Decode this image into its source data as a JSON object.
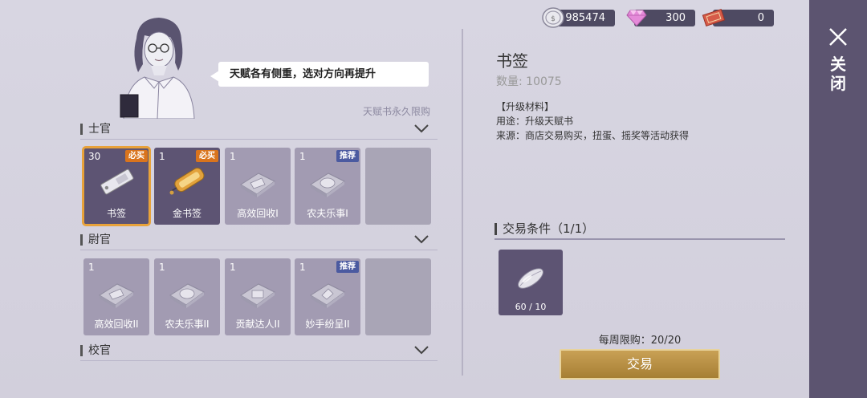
{
  "currency": {
    "silver": "985474",
    "gems": "300",
    "tickets": "0"
  },
  "bubble_text": "天赋各有侧重，选对方向再提升",
  "perm_note": "天赋书永久限购",
  "close_label": "关闭",
  "sections": [
    {
      "title": "士官",
      "items": [
        {
          "count": "30",
          "name": "书签",
          "badge": "必买",
          "badge_type": "must"
        },
        {
          "count": "1",
          "name": "金书签",
          "badge": "必买",
          "badge_type": "must"
        },
        {
          "count": "1",
          "name": "高效回收I",
          "badge": "",
          "badge_type": ""
        },
        {
          "count": "1",
          "name": "农夫乐事I",
          "badge": "推荐",
          "badge_type": "rec"
        }
      ]
    },
    {
      "title": "尉官",
      "items": [
        {
          "count": "1",
          "name": "高效回收II",
          "badge": "",
          "badge_type": ""
        },
        {
          "count": "1",
          "name": "农夫乐事II",
          "badge": "",
          "badge_type": ""
        },
        {
          "count": "1",
          "name": "贡献达人II",
          "badge": "",
          "badge_type": ""
        },
        {
          "count": "1",
          "name": "妙手纷呈II",
          "badge": "推荐",
          "badge_type": "rec"
        }
      ]
    },
    {
      "title": "校官",
      "items": []
    }
  ],
  "detail": {
    "title": "书签",
    "qty_label": "数量: 10075",
    "category": "【升级材料】",
    "usage": "用途：升级天赋书",
    "source": "来源：商店交易购买，扭蛋、摇奖等活动获得"
  },
  "trade": {
    "title": "交易条件（1/1）",
    "material_amount": "60 / 10",
    "weekly_limit": "每周限购：20/20",
    "button_label": "交易"
  }
}
